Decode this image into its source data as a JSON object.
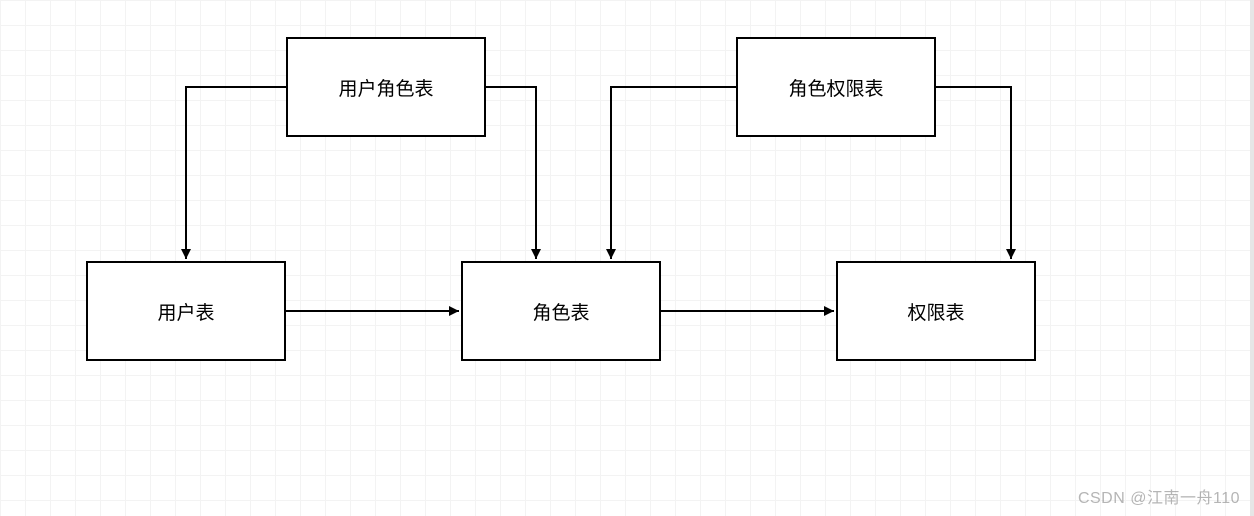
{
  "diagram": {
    "nodes": {
      "user_role_table": {
        "label": "用户角色表"
      },
      "role_permission_table": {
        "label": "角色权限表"
      },
      "user_table": {
        "label": "用户表"
      },
      "role_table": {
        "label": "角色表"
      },
      "permission_table": {
        "label": "权限表"
      }
    },
    "edges": [
      {
        "from": "user_role_table",
        "to": "user_table"
      },
      {
        "from": "user_role_table",
        "to": "role_table"
      },
      {
        "from": "role_permission_table",
        "to": "role_table"
      },
      {
        "from": "role_permission_table",
        "to": "permission_table"
      },
      {
        "from": "user_table",
        "to": "role_table"
      },
      {
        "from": "role_table",
        "to": "permission_table"
      }
    ]
  },
  "watermark": "CSDN @江南一舟110"
}
